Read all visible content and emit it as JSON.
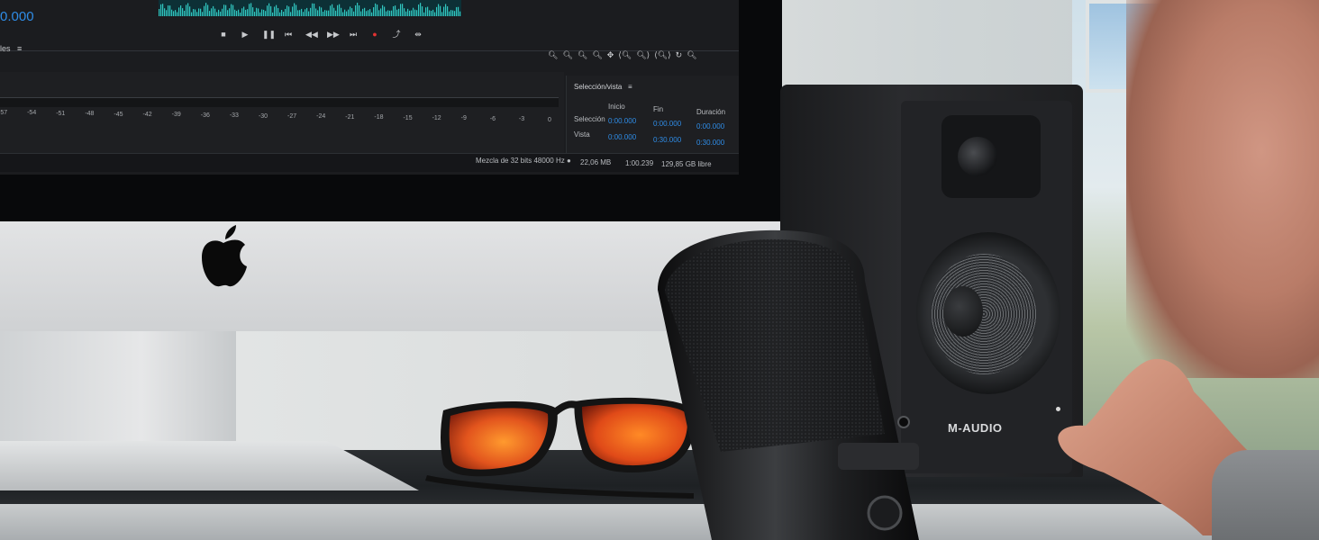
{
  "editor": {
    "timecode": "0.000",
    "panel_title": "les",
    "transport_buttons": [
      "stop",
      "play",
      "pause",
      "skip-back",
      "rewind",
      "fast-forward",
      "skip-forward",
      "record",
      "loop",
      "skip-selection"
    ],
    "zoom_buttons": [
      "zoom-in-amplitude",
      "zoom-out-amplitude",
      "zoom-in-time",
      "zoom-out-time",
      "zoom-full",
      "zoom-in-left",
      "zoom-out-right",
      "zoom-selection",
      "zoom-reset",
      "zoom-tracks"
    ],
    "meter_ticks": [
      "-57",
      "-54",
      "-51",
      "-48",
      "-45",
      "-42",
      "-39",
      "-36",
      "-33",
      "-30",
      "-27",
      "-24",
      "-21",
      "-18",
      "-15",
      "-12",
      "-9",
      "-6",
      "-3",
      "0"
    ],
    "selection_panel": {
      "title": "Selección/vista",
      "col_start": "Inicio",
      "col_end": "Fin",
      "col_duration": "Duración",
      "rows": [
        {
          "label": "Selección",
          "start": "0:00.000",
          "end": "0:00.000",
          "duration": "0:00.000"
        },
        {
          "label": "Vista",
          "start": "0:00.000",
          "end": "0:30.000",
          "duration": "0:30.000"
        }
      ]
    },
    "status": {
      "mix": "Mezcla de 32 bits 48000 Hz ●",
      "size": "22,06 MB",
      "duration": "1:00.239",
      "free": "129,85 GB libre"
    },
    "colors": {
      "accent": "#2f8ce6",
      "record": "#e23232",
      "panel": "#1e1f22"
    }
  },
  "speaker": {
    "brand": "M-AUDIO"
  }
}
